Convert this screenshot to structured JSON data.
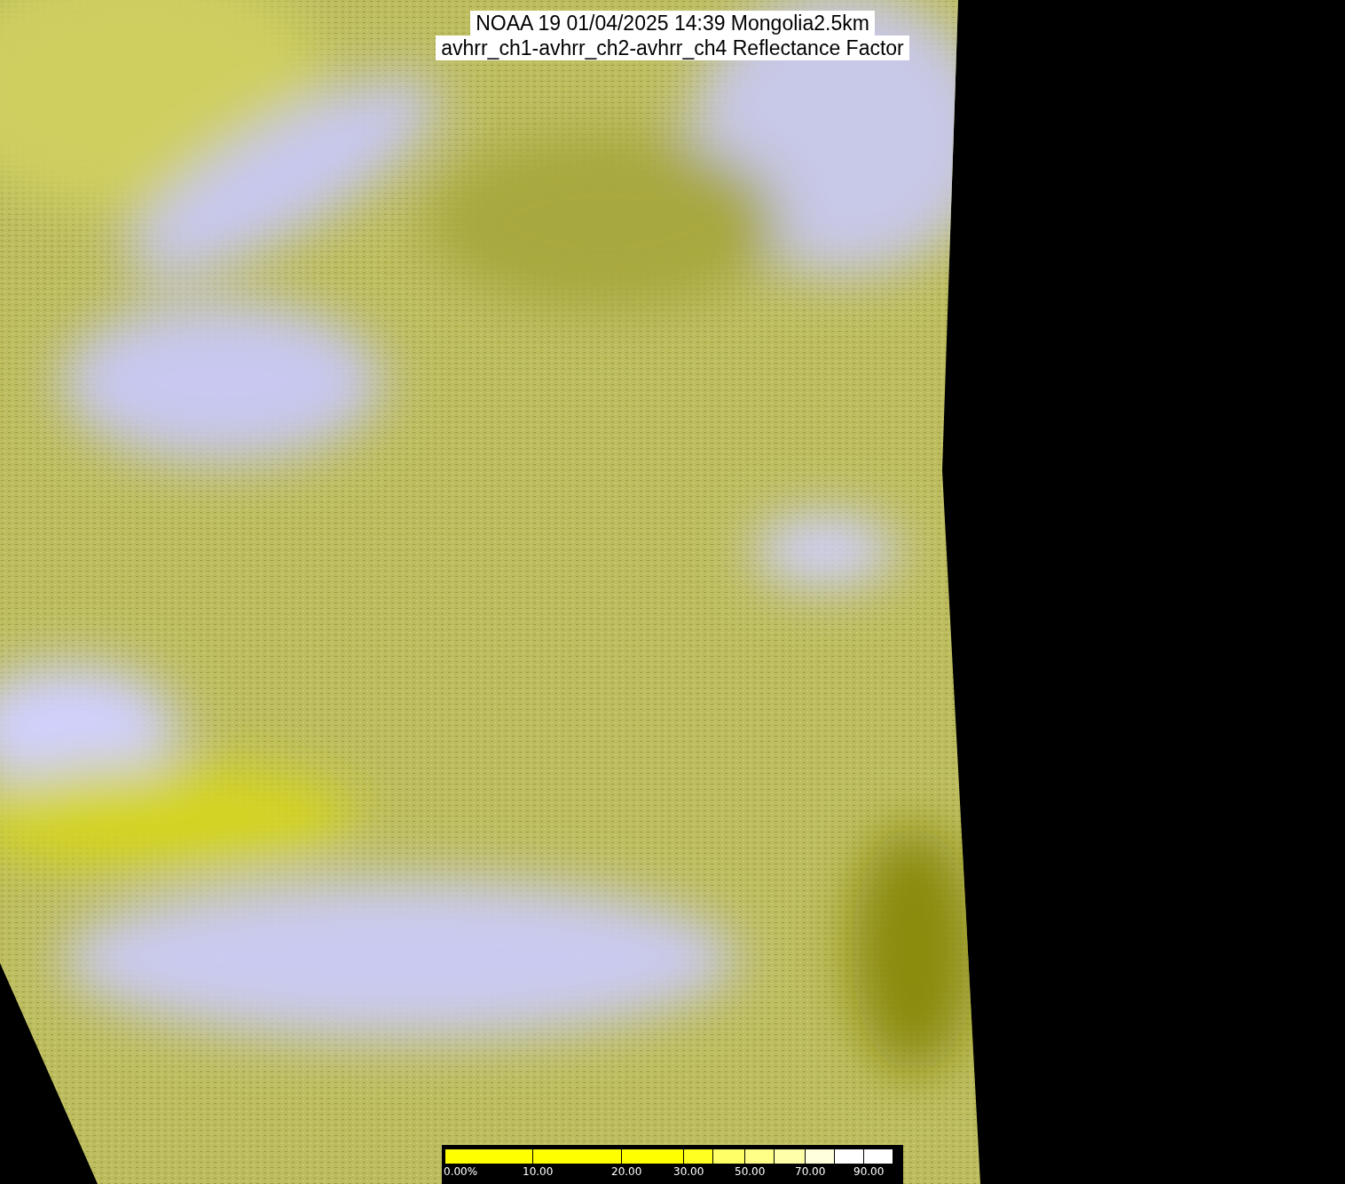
{
  "title_lines": [
    "NOAA 19 01/04/2025 14:39 Mongolia2.5km",
    "avhrr_ch1-avhrr_ch2-avhrr_ch4 Reflectance Factor"
  ],
  "colorbar": {
    "segments": [
      {
        "color": "#ffff00",
        "label": "0.00%"
      },
      {
        "color": "#ffff00",
        "label": "10.00"
      },
      {
        "color": "#ffff00",
        "label": "20.00"
      },
      {
        "color": "#ffff22",
        "label": "30.00"
      },
      {
        "color": "#ffff66"
      },
      {
        "color": "#ffff88",
        "label": "50.00"
      },
      {
        "color": "#ffffaa"
      },
      {
        "color": "#ffffdd",
        "label": "70.00"
      },
      {
        "color": "#ffffff"
      },
      {
        "color": "#ffffff",
        "label": "90.00"
      }
    ]
  }
}
